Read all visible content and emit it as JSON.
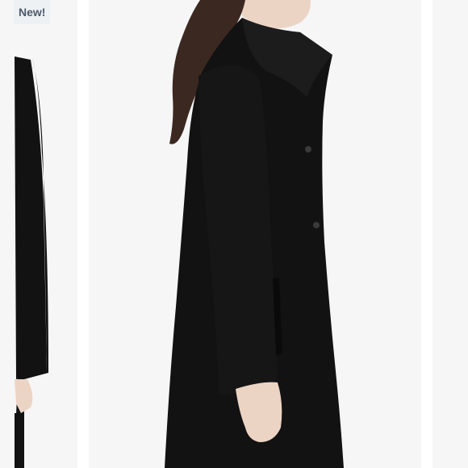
{
  "listing": {
    "badge_label": "New!"
  },
  "gallery": {
    "previous_slide_icon": "coat-photo-partial",
    "current_slide_icon": "coat-photo-side-view",
    "next_slide_icon": "blank-photo-partial"
  },
  "colors": {
    "background": "#f6f6f6",
    "coat": "#121212",
    "skin": "#ecd4c5",
    "hair": "#3b2820",
    "badge_bg": "#eef1f4",
    "badge_text": "#4b5a6b"
  }
}
